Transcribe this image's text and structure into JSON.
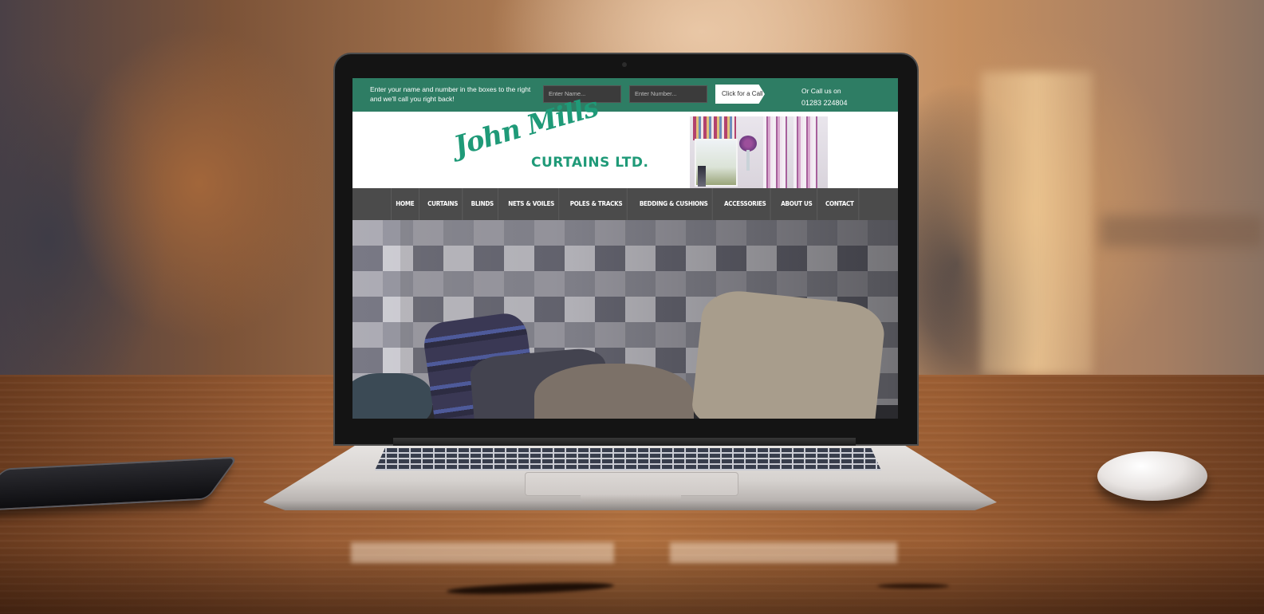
{
  "website": {
    "topbar": {
      "message": "Enter your name and number in the boxes to the right and we'll call you right back!",
      "name_placeholder": "Enter Name...",
      "number_placeholder": "Enter Number...",
      "call_button": "Click for a Call",
      "call_label": "Or Call us on",
      "phone": "01283 224804"
    },
    "logo": {
      "line1": "John Mills",
      "line2": "CURTAINS LTD."
    },
    "nav": [
      "HOME",
      "CURTAINS",
      "BLINDS",
      "NETS & VOILES",
      "POLES & TRACKS",
      "BEDDING & CUSHIONS",
      "ACCESSORIES",
      "ABOUT US",
      "CONTACT"
    ],
    "colors": {
      "brand_green": "#2e7d64",
      "logo_green": "#1f9a78",
      "nav_bg": "#4b4b4b"
    }
  },
  "scene": {
    "objects": [
      "laptop",
      "smartphone",
      "mouse",
      "wooden-desk"
    ]
  }
}
